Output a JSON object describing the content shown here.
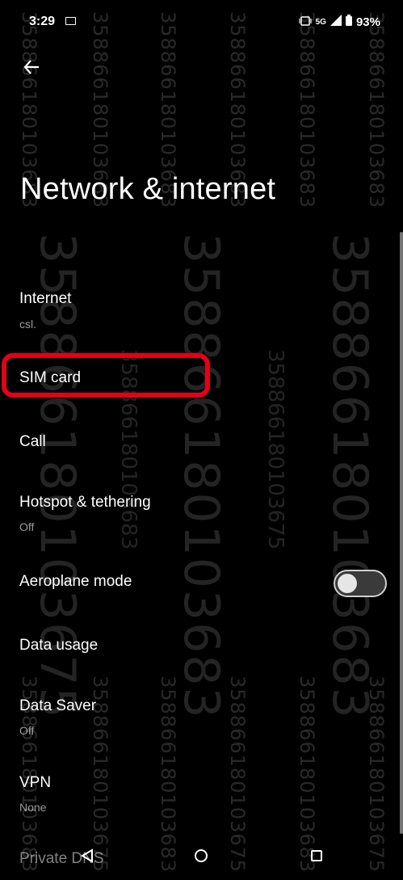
{
  "watermark": {
    "text": "358866180103683",
    "alt_text": "358866180103675"
  },
  "status_bar": {
    "time": "3:29",
    "network": "5G",
    "battery": "93%"
  },
  "page": {
    "title": "Network & internet"
  },
  "items": [
    {
      "label": "Internet",
      "sub": "csl."
    },
    {
      "label": "SIM card",
      "sub": ""
    },
    {
      "label": "Call",
      "sub": ""
    },
    {
      "label": "Hotspot & tethering",
      "sub": "Off"
    },
    {
      "label": "Aeroplane mode",
      "sub": ""
    },
    {
      "label": "Data usage",
      "sub": ""
    },
    {
      "label": "Data Saver",
      "sub": "Off"
    },
    {
      "label": "VPN",
      "sub": "None"
    },
    {
      "label": "Private DNS",
      "sub": ""
    }
  ],
  "toggles": {
    "aeroplane_mode": "off"
  },
  "icons": {
    "back": "back-arrow-icon",
    "nav_back": "nav-back-icon",
    "nav_home": "nav-home-icon",
    "nav_recent": "nav-recents-icon"
  }
}
